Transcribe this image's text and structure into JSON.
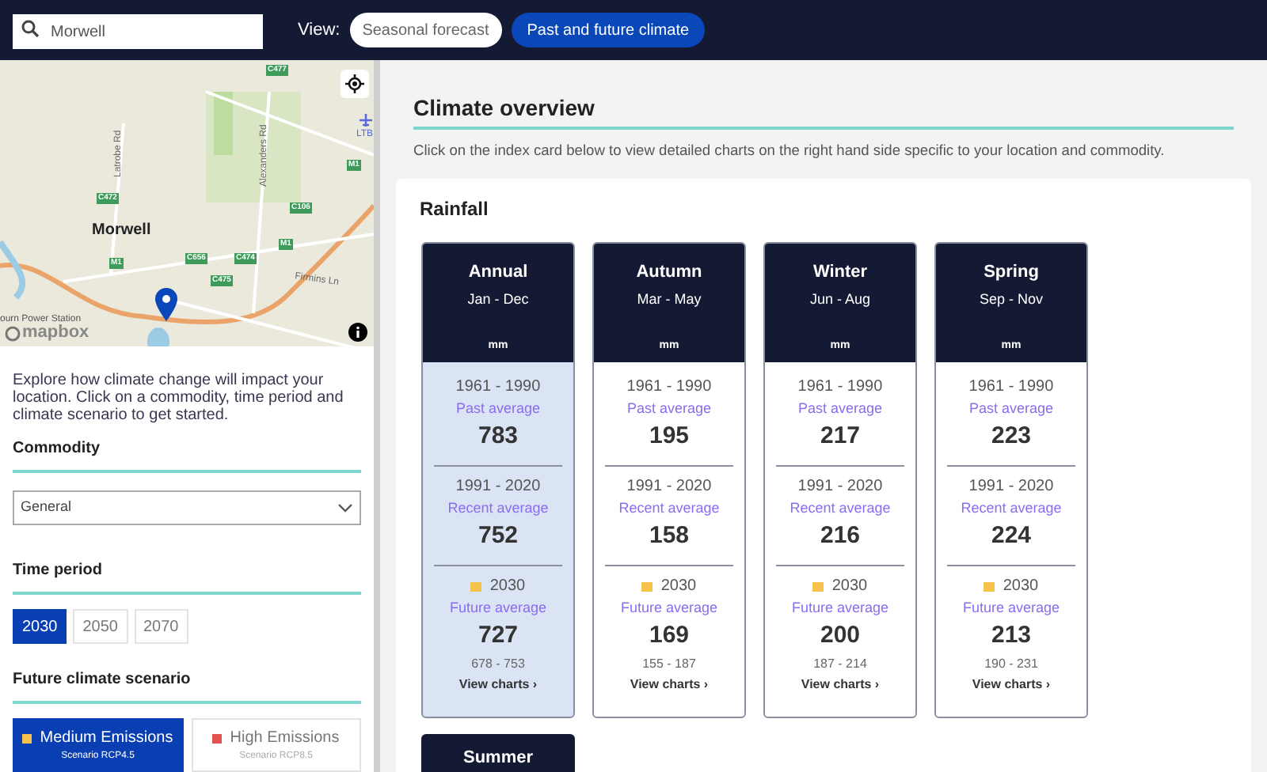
{
  "search": {
    "value": "Morwell"
  },
  "view": {
    "label": "View:",
    "options": [
      {
        "label": "Seasonal forecast",
        "selected": false
      },
      {
        "label": "Past and future climate",
        "selected": true
      }
    ]
  },
  "map": {
    "labels": [
      {
        "kind": "place",
        "text": "Morwell"
      },
      {
        "kind": "road",
        "text": "Latrobe Rd"
      },
      {
        "kind": "road",
        "text": "Alexanders Rd"
      },
      {
        "kind": "road",
        "text": "Firmins Ln"
      },
      {
        "kind": "airport",
        "text": "LTB"
      },
      {
        "kind": "place",
        "text": "ourn Power Station"
      },
      {
        "kind": "shield",
        "text": "C477"
      },
      {
        "kind": "shield",
        "text": "C472"
      },
      {
        "kind": "shield",
        "text": "C106"
      },
      {
        "kind": "shield",
        "text": "M1"
      },
      {
        "kind": "shield",
        "text": "M1"
      },
      {
        "kind": "shield",
        "text": "M1"
      },
      {
        "kind": "shield",
        "text": "C656"
      },
      {
        "kind": "shield",
        "text": "C474"
      },
      {
        "kind": "shield",
        "text": "C475"
      }
    ],
    "attribution": "mapbox"
  },
  "sidebar": {
    "intro": "Explore how climate change will impact your location. Click on a commodity, time period and climate scenario to get started.",
    "commodity": {
      "heading": "Commodity",
      "value": "General"
    },
    "time_period": {
      "heading": "Time period",
      "options": [
        {
          "label": "2030",
          "selected": true
        },
        {
          "label": "2050",
          "selected": false
        },
        {
          "label": "2070",
          "selected": false
        }
      ]
    },
    "scenario": {
      "heading": "Future climate scenario",
      "options": [
        {
          "label": "Medium Emissions",
          "sub": "Scenario RCP4.5",
          "color": "#f5c24b",
          "selected": true
        },
        {
          "label": "High Emissions",
          "sub": "Scenario RCP8.5",
          "color": "#e0534f",
          "selected": false
        }
      ]
    }
  },
  "overview": {
    "title": "Climate overview",
    "description": "Click on the index card below to view detailed charts on the right hand side specific to your location and commodity.",
    "section": "Rainfall",
    "cards": [
      {
        "season": "Annual",
        "months": "Jan - Dec",
        "unit": "mm",
        "selected": true,
        "past_period": "1961 - 1990",
        "past_label": "Past average",
        "past": "783",
        "recent_period": "1991 - 2020",
        "recent_label": "Recent average",
        "recent": "752",
        "future_period": "2030",
        "future_label": "Future average",
        "future": "727",
        "range": "678 - 753",
        "link": "View charts ›"
      },
      {
        "season": "Autumn",
        "months": "Mar - May",
        "unit": "mm",
        "selected": false,
        "past_period": "1961 - 1990",
        "past_label": "Past average",
        "past": "195",
        "recent_period": "1991 - 2020",
        "recent_label": "Recent average",
        "recent": "158",
        "future_period": "2030",
        "future_label": "Future average",
        "future": "169",
        "range": "155 - 187",
        "link": "View charts ›"
      },
      {
        "season": "Winter",
        "months": "Jun - Aug",
        "unit": "mm",
        "selected": false,
        "past_period": "1961 - 1990",
        "past_label": "Past average",
        "past": "217",
        "recent_period": "1991 - 2020",
        "recent_label": "Recent average",
        "recent": "216",
        "future_period": "2030",
        "future_label": "Future average",
        "future": "200",
        "range": "187 - 214",
        "link": "View charts ›"
      },
      {
        "season": "Spring",
        "months": "Sep - Nov",
        "unit": "mm",
        "selected": false,
        "past_period": "1961 - 1990",
        "past_label": "Past average",
        "past": "223",
        "recent_period": "1991 - 2020",
        "recent_label": "Recent average",
        "recent": "224",
        "future_period": "2030",
        "future_label": "Future average",
        "future": "213",
        "range": "190 - 231",
        "link": "View charts ›"
      },
      {
        "season": "Summer",
        "partial": true
      }
    ]
  }
}
